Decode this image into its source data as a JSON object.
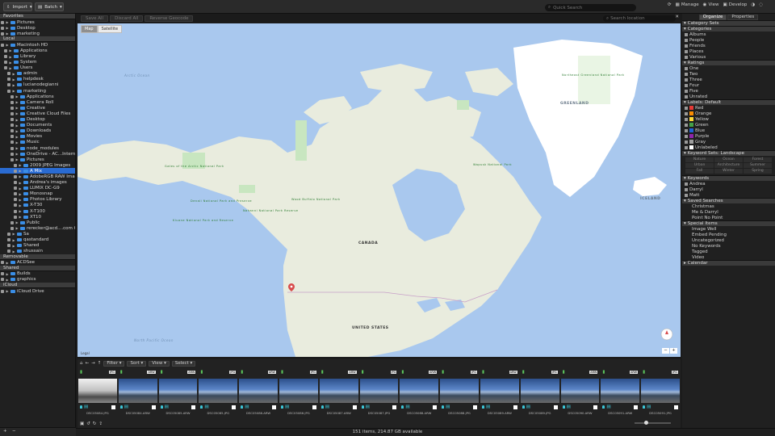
{
  "toolbar": {
    "import_label": "Import",
    "batch_label": "Batch",
    "search_placeholder": "Quick Search",
    "manage_label": "Manage",
    "view_label": "View",
    "develop_label": "Develop"
  },
  "left": {
    "sections": [
      {
        "title": "Favorites",
        "items": [
          "Pictures",
          "Desktop",
          "marketing"
        ]
      },
      {
        "title": "Local",
        "items": [
          "Macintosh HD",
          "Applications",
          "Library",
          "System",
          "Users",
          "admin",
          "helpdesk",
          "lucianodegianni",
          "marketing",
          "Applications",
          "Camera Roll",
          "Creative",
          "Creative Cloud Files",
          "Desktop",
          "Documents",
          "Downloads",
          "Movies",
          "Music",
          "node_modules",
          "OneDrive - AC...International Inc",
          "Pictures",
          "2009 JPEG Images",
          "A Mix",
          "AdobeRGB RAW Images",
          "Andrea's images",
          "LUMIX DC-G9",
          "Monosnap",
          "Photos Library",
          "X-T30",
          "X-T100",
          "XT10",
          "Public",
          "rerecker@acd....com Creative",
          "Sa",
          "qastandard",
          "Shared",
          "shussain"
        ]
      },
      {
        "title": "Removable",
        "items": [
          "ACDSee"
        ]
      },
      {
        "title": "Shared",
        "items": [
          "Builds",
          "graphics"
        ]
      },
      {
        "title": "iCloud",
        "items": [
          "iCloud Drive"
        ]
      }
    ]
  },
  "center": {
    "save_all": "Save All",
    "discard_all": "Discard All",
    "reverse_geocode": "Reverse Geocode",
    "search_location": "Search location",
    "map_tab": "Map",
    "satellite_tab": "Satellite",
    "labels": {
      "arctic": "Arctic Ocean",
      "greenland": "GREENLAND",
      "iceland": "ICELAND",
      "canada": "CANADA",
      "us": "UNITED STATES",
      "pacific": "North Pacific Ocean",
      "legal": "Legal"
    },
    "parks": [
      "Gates of the Arctic National Park",
      "Wapusk National Park",
      "Denali National Park and Preserve",
      "Wood Buffalo National Park",
      "Nahanni National Park Reserve",
      "Kluane National Park and Reserve",
      "Northeast Greenland National Park"
    ]
  },
  "filmstrip": {
    "filter": "Filter",
    "sort": "Sort",
    "view": "View",
    "select": "Select",
    "thumbs": [
      {
        "name": "DSC05084.JPG",
        "fmt": "JPG"
      },
      {
        "name": "DSC05084.ARW",
        "fmt": "ARW"
      },
      {
        "name": "DSC05085.ARW",
        "fmt": "ARW"
      },
      {
        "name": "DSC05085.JPG",
        "fmt": "JPG"
      },
      {
        "name": "DSC05086.ARW",
        "fmt": "ARW"
      },
      {
        "name": "DSC05086.JPG",
        "fmt": "JPG"
      },
      {
        "name": "DSC05087.ARW",
        "fmt": "ARW"
      },
      {
        "name": "DSC05087.JPG",
        "fmt": "JPG"
      },
      {
        "name": "DSC05088.ARW",
        "fmt": "ARW"
      },
      {
        "name": "DSC05088.JPG",
        "fmt": "JPG"
      },
      {
        "name": "DSC05089.ARW",
        "fmt": "ARW"
      },
      {
        "name": "DSC05089.JPG",
        "fmt": "JPG"
      },
      {
        "name": "DSC05090.ARW",
        "fmt": "ARW"
      },
      {
        "name": "DSC05091.ARW",
        "fmt": "ARW"
      },
      {
        "name": "DSC05091.JPG",
        "fmt": "JPG"
      }
    ]
  },
  "status": "151 items, 214.87 GB available",
  "right": {
    "tabs": [
      "Organize",
      "Properties"
    ],
    "category_sets": "Category Sets",
    "categories": "Categories",
    "cat_items": [
      "Albums",
      "People",
      "Friends",
      "Places",
      "Various"
    ],
    "ratings": "Ratings",
    "rating_items": [
      "One",
      "Two",
      "Three",
      "Four",
      "Five",
      "Unrated"
    ],
    "labels": "Labels: Default",
    "label_items": [
      {
        "n": "Red",
        "c": "#e53935"
      },
      {
        "n": "Orange",
        "c": "#fb8c00"
      },
      {
        "n": "Yellow",
        "c": "#fdd835"
      },
      {
        "n": "Green",
        "c": "#43a047"
      },
      {
        "n": "Blue",
        "c": "#1e63d6"
      },
      {
        "n": "Purple",
        "c": "#8e24aa"
      },
      {
        "n": "Gray",
        "c": "#9e9e9e"
      },
      {
        "n": "Unlabeled",
        "c": "#ffffff"
      }
    ],
    "keyword_sets": "Keyword Sets: Landscape",
    "kw_cells": [
      "Nature",
      "Ocean",
      "Forest",
      "Urban",
      "Architecture",
      "Summer",
      "Fall",
      "Winter",
      "Spring"
    ],
    "keywords": "Keywords",
    "kw_items": [
      "Andrea",
      "Darryl",
      "Matt"
    ],
    "saved": "Saved Searches",
    "saved_items": [
      "Christmas",
      "Me & Darryl",
      "Point No Point"
    ],
    "special": "Special Items",
    "special_items": [
      "Image Well",
      "Embed Pending",
      "Uncategorized",
      "No Keywords",
      "Tagged",
      "Video"
    ],
    "calendar": "Calendar"
  }
}
